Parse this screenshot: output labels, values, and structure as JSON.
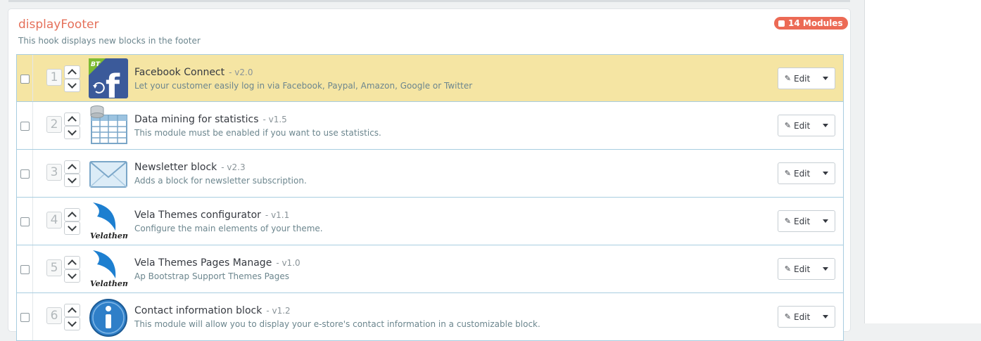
{
  "hook": {
    "title": "displayFooter",
    "description": "This hook displays new blocks in the footer",
    "badge_label": "14 Modules",
    "accent_color": "#ec6a55"
  },
  "modules": [
    {
      "position": "1",
      "name": "Facebook Connect",
      "version": "- v2.0",
      "description": "Let your customer easily log in via Facebook, Paypal, Amazon, Google or Twitter",
      "logo_icon": "facebook-connect-logo-icon",
      "logo_badge": "BT",
      "highlighted": true,
      "edit_label": "Edit"
    },
    {
      "position": "2",
      "name": "Data mining for statistics",
      "version": "- v1.5",
      "description": "This module must be enabled if you want to use statistics.",
      "logo_icon": "statistics-table-icon",
      "highlighted": false,
      "edit_label": "Edit"
    },
    {
      "position": "3",
      "name": "Newsletter block",
      "version": "- v2.3",
      "description": "Adds a block for newsletter subscription.",
      "logo_icon": "envelope-icon",
      "highlighted": false,
      "edit_label": "Edit"
    },
    {
      "position": "4",
      "name": "Vela Themes configurator",
      "version": "- v1.1",
      "description": "Configure the main elements of your theme.",
      "logo_icon": "velatheme-logo-icon",
      "logo_text": "Velatheme",
      "highlighted": false,
      "edit_label": "Edit"
    },
    {
      "position": "5",
      "name": "Vela Themes Pages Manage",
      "version": "- v1.0",
      "description": "Ap Bootstrap Support Themes Pages",
      "logo_icon": "velatheme-logo-icon",
      "logo_text": "Velatheme",
      "highlighted": false,
      "edit_label": "Edit"
    },
    {
      "position": "6",
      "name": "Contact information block",
      "version": "- v1.2",
      "description": "This module will allow you to display your e-store's contact information in a customizable block.",
      "logo_icon": "info-circle-icon",
      "highlighted": false,
      "edit_label": "Edit"
    }
  ]
}
